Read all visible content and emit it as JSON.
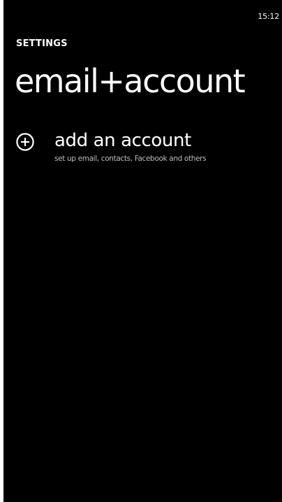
{
  "status_bar": {
    "time": "15:12"
  },
  "header": {
    "app_title": "SETTINGS",
    "page_title": "email+account"
  },
  "accounts": {
    "add_account": {
      "icon": "plus-circle-icon",
      "title": "add an account",
      "subtitle": "set up email, contacts, Facebook and others"
    }
  },
  "colors": {
    "background": "#000000",
    "text": "#ffffff",
    "subtle_text": "#bcbcbc"
  }
}
